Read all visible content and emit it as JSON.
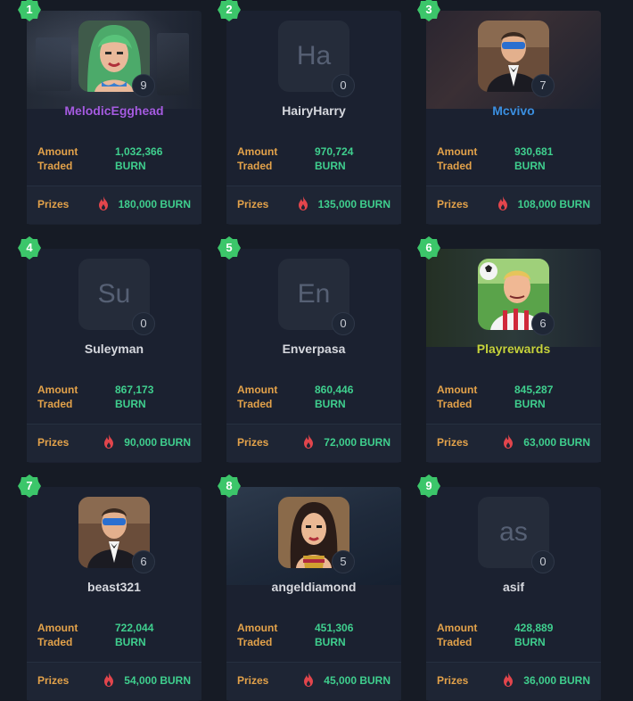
{
  "labels": {
    "amount_traded": "Amount Traded",
    "prizes": "Prizes"
  },
  "colors": {
    "accent_green": "#3fcf8e",
    "label_orange": "#e3a24a",
    "badge_green": "#3cc66a",
    "fire_red": "#e2454c"
  },
  "players": [
    {
      "rank": "1",
      "name": "MelodicEgghead",
      "name_color": "#a55be0",
      "level": "9",
      "initials": "",
      "amount": "1,032,366",
      "unit": "BURN",
      "prize": "180,000 BURN",
      "avatar": "green-hair-girl-portrait"
    },
    {
      "rank": "2",
      "name": "HairyHarry",
      "name_color": "#d6d8de",
      "level": "0",
      "initials": "Ha",
      "amount": "970,724",
      "unit": "BURN",
      "prize": "135,000 BURN",
      "avatar": ""
    },
    {
      "rank": "3",
      "name": "Mcvivo",
      "name_color": "#3b8fe0",
      "level": "7",
      "initials": "",
      "amount": "930,681",
      "unit": "BURN",
      "prize": "108,000 BURN",
      "avatar": "masked-man-tuxedo-portrait"
    },
    {
      "rank": "4",
      "name": "Suleyman",
      "name_color": "#d6d8de",
      "level": "0",
      "initials": "Su",
      "amount": "867,173",
      "unit": "BURN",
      "prize": "90,000 BURN",
      "avatar": ""
    },
    {
      "rank": "5",
      "name": "Enverpasa",
      "name_color": "#d6d8de",
      "level": "0",
      "initials": "En",
      "amount": "860,446",
      "unit": "BURN",
      "prize": "72,000 BURN",
      "avatar": ""
    },
    {
      "rank": "6",
      "name": "Playrewards",
      "name_color": "#c7d43a",
      "level": "6",
      "initials": "",
      "amount": "845,287",
      "unit": "BURN",
      "prize": "63,000 BURN",
      "avatar": "soccer-player-portrait"
    },
    {
      "rank": "7",
      "name": "beast321",
      "name_color": "#d6d8de",
      "level": "6",
      "initials": "",
      "amount": "722,044",
      "unit": "BURN",
      "prize": "54,000 BURN",
      "avatar": "masked-man-tuxedo-portrait"
    },
    {
      "rank": "8",
      "name": "angeldiamond",
      "name_color": "#d6d8de",
      "level": "5",
      "initials": "",
      "amount": "451,306",
      "unit": "BURN",
      "prize": "45,000 BURN",
      "avatar": "dark-hair-woman-portrait"
    },
    {
      "rank": "9",
      "name": "asif",
      "name_color": "#d6d8de",
      "level": "0",
      "initials": "as",
      "amount": "428,889",
      "unit": "BURN",
      "prize": "36,000 BURN",
      "avatar": ""
    }
  ]
}
